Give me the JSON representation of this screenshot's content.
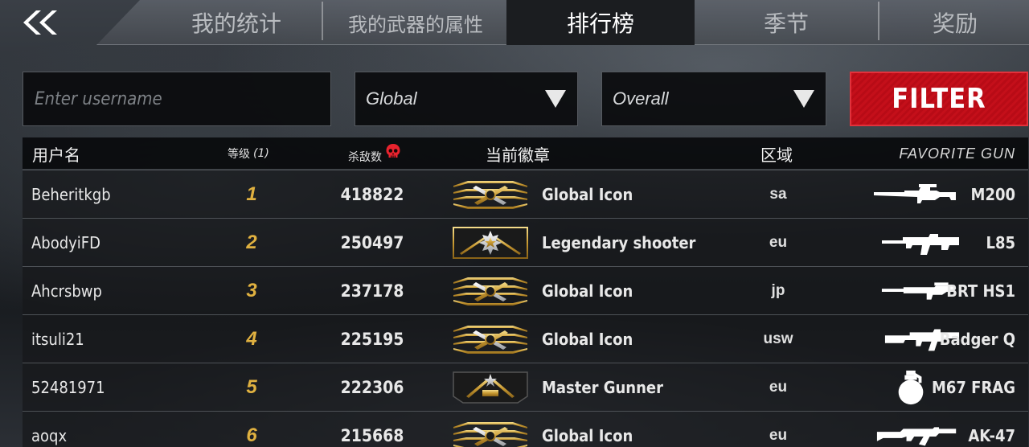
{
  "nav": {
    "back_icon": "double-chevron-left-icon",
    "tabs": [
      {
        "label": "我的统计",
        "active": false
      },
      {
        "label": "我的武器的属性",
        "active": false
      },
      {
        "label": "排行榜",
        "active": true
      },
      {
        "label": "季节",
        "active": false
      },
      {
        "label": "奖励",
        "active": false
      }
    ]
  },
  "filters": {
    "username_placeholder": "Enter username",
    "region_value": "Global",
    "mode_value": "Overall",
    "filter_label": "FILTER"
  },
  "table": {
    "headers": {
      "user": "用户名",
      "level": "等级",
      "level_suffix": "(1)",
      "kills": "杀敌数",
      "badge": "当前徽章",
      "region": "区域",
      "gun": "FAVORITE GUN"
    },
    "rows": [
      {
        "username": "Beheritkgb",
        "rank": "1",
        "kills": "418822",
        "badge": "Global Icon",
        "badge_icon": "global-icon-badge",
        "region": "sa",
        "gun": "M200",
        "gun_icon": "sniper-rifle-icon"
      },
      {
        "username": "AbodyiFD",
        "rank": "2",
        "kills": "250497",
        "badge": "Legendary shooter",
        "badge_icon": "legendary-shooter-badge",
        "region": "eu",
        "gun": "L85",
        "gun_icon": "bullpup-rifle-icon"
      },
      {
        "username": "Ahcrsbwp",
        "rank": "3",
        "kills": "237178",
        "badge": "Global Icon",
        "badge_icon": "global-icon-badge",
        "region": "jp",
        "gun": "BRT HS1",
        "gun_icon": "marksman-rifle-icon"
      },
      {
        "username": "itsuli21",
        "rank": "4",
        "kills": "225195",
        "badge": "Global Icon",
        "badge_icon": "global-icon-badge",
        "region": "usw",
        "gun": "Badger Q",
        "gun_icon": "assault-rifle-icon"
      },
      {
        "username": "52481971",
        "rank": "5",
        "kills": "222306",
        "badge": "Master Gunner",
        "badge_icon": "master-gunner-badge",
        "region": "eu",
        "gun": "M67 FRAG",
        "gun_icon": "grenade-icon"
      },
      {
        "username": "aoqx",
        "rank": "6",
        "kills": "215668",
        "badge": "Global Icon",
        "badge_icon": "global-icon-badge",
        "region": "eu",
        "gun": "AK-47",
        "gun_icon": "ak-rifle-icon"
      }
    ]
  },
  "colors": {
    "accent_red": "#c40f1a",
    "rank_gold": "#e0b140",
    "skull_red": "#e8232e"
  }
}
